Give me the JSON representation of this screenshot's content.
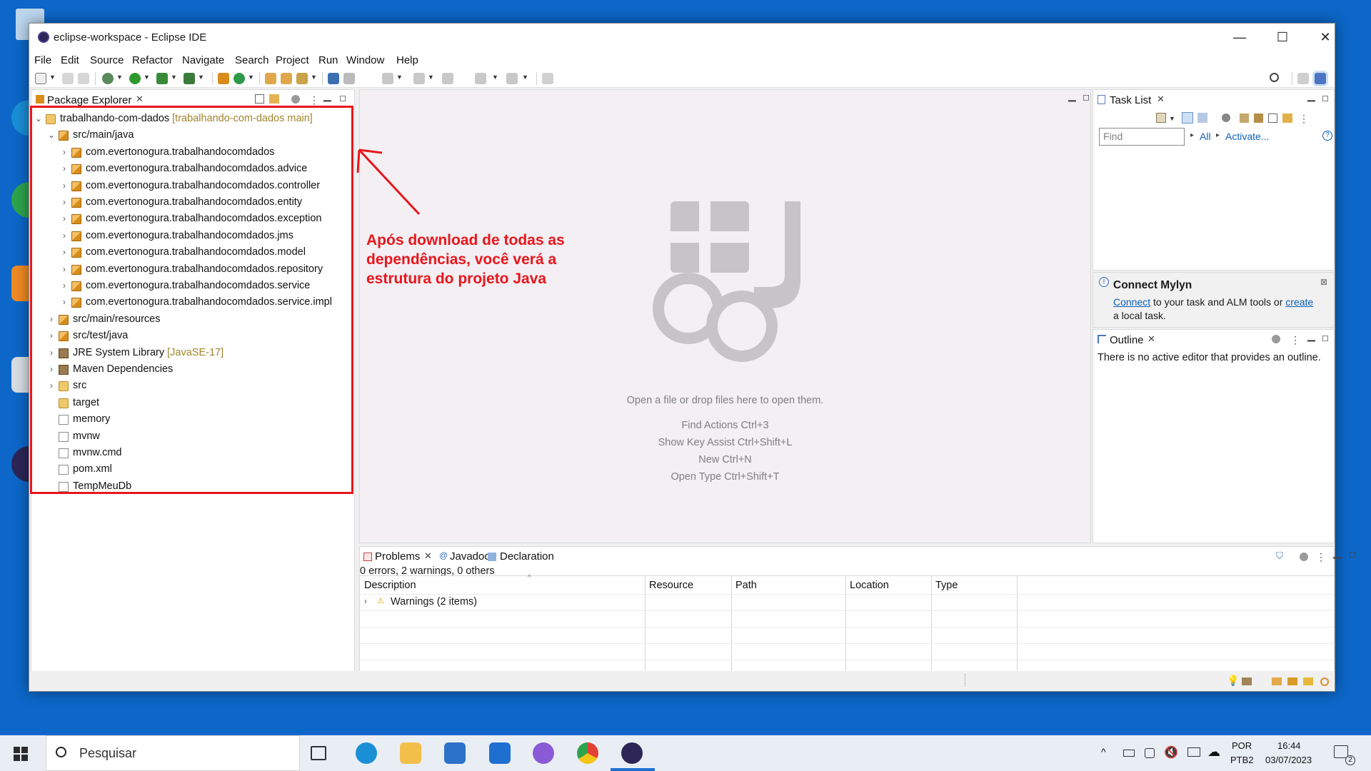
{
  "window": {
    "title": "eclipse-workspace - Eclipse IDE",
    "minimize": "—",
    "maximize": "☐",
    "close": "✕"
  },
  "menu": [
    "File",
    "Edit",
    "Source",
    "Refactor",
    "Navigate",
    "Search",
    "Project",
    "Run",
    "Window",
    "Help"
  ],
  "package_explorer": {
    "tab": "Package Explorer",
    "tree": [
      {
        "label": "trabalhando-com-dados",
        "deco": "[trabalhando-com-dados main]",
        "icon": "project-icon",
        "toggle": "⌄"
      },
      {
        "label": "src/main/java",
        "deco": "",
        "icon": "source-folder-icon",
        "toggle": "⌄"
      },
      {
        "label": "com.evertonogura.trabalhandocomdados",
        "deco": "",
        "icon": "package-icon",
        "toggle": "›"
      },
      {
        "label": "com.evertonogura.trabalhandocomdados.advice",
        "deco": "",
        "icon": "package-icon",
        "toggle": "›"
      },
      {
        "label": "com.evertonogura.trabalhandocomdados.controller",
        "deco": "",
        "icon": "package-icon",
        "toggle": "›"
      },
      {
        "label": "com.evertonogura.trabalhandocomdados.entity",
        "deco": "",
        "icon": "package-icon",
        "toggle": "›"
      },
      {
        "label": "com.evertonogura.trabalhandocomdados.exception",
        "deco": "",
        "icon": "package-icon",
        "toggle": "›"
      },
      {
        "label": "com.evertonogura.trabalhandocomdados.jms",
        "deco": "",
        "icon": "package-icon",
        "toggle": "›"
      },
      {
        "label": "com.evertonogura.trabalhandocomdados.model",
        "deco": "",
        "icon": "package-icon",
        "toggle": "›"
      },
      {
        "label": "com.evertonogura.trabalhandocomdados.repository",
        "deco": "",
        "icon": "package-icon",
        "toggle": "›"
      },
      {
        "label": "com.evertonogura.trabalhandocomdados.service",
        "deco": "",
        "icon": "package-icon",
        "toggle": "›"
      },
      {
        "label": "com.evertonogura.trabalhandocomdados.service.impl",
        "deco": "",
        "icon": "package-icon",
        "toggle": "›"
      },
      {
        "label": "src/main/resources",
        "deco": "",
        "icon": "source-folder-icon",
        "toggle": "›"
      },
      {
        "label": "src/test/java",
        "deco": "",
        "icon": "source-folder-icon",
        "toggle": "›"
      },
      {
        "label": "JRE System Library",
        "deco": "[JavaSE-17]",
        "icon": "library-icon",
        "toggle": "›"
      },
      {
        "label": "Maven Dependencies",
        "deco": "",
        "icon": "library-icon",
        "toggle": "›"
      },
      {
        "label": "src",
        "deco": "",
        "icon": "folder-icon",
        "toggle": "›"
      },
      {
        "label": "target",
        "deco": "",
        "icon": "folder-icon",
        "toggle": ""
      },
      {
        "label": "memory",
        "deco": "",
        "icon": "file-icon",
        "toggle": ""
      },
      {
        "label": "mvnw",
        "deco": "",
        "icon": "file-icon",
        "toggle": ""
      },
      {
        "label": "mvnw.cmd",
        "deco": "",
        "icon": "file-icon",
        "toggle": ""
      },
      {
        "label": "pom.xml",
        "deco": "",
        "icon": "xml-file-icon",
        "toggle": ""
      },
      {
        "label": "TempMeuDb",
        "deco": "",
        "icon": "file-icon",
        "toggle": ""
      }
    ]
  },
  "annotation": {
    "text": "Após download de todas as dependências, você verá a estrutura do projeto Java"
  },
  "editor": {
    "open_hint": "Open a file or drop files here to open them.",
    "shortcuts": [
      "Find Actions Ctrl+3",
      "Show Key Assist Ctrl+Shift+L",
      "New Ctrl+N",
      "Open Type Ctrl+Shift+T"
    ]
  },
  "task_list": {
    "tab": "Task List",
    "find_placeholder": "Find",
    "all": "All",
    "activate": "Activate..."
  },
  "mylyn": {
    "title": "Connect Mylyn",
    "connect": "Connect",
    "middle": " to your task and ALM tools or ",
    "create": "create",
    "end": "a local task."
  },
  "outline": {
    "tab": "Outline",
    "message": "There is no active editor that provides an outline."
  },
  "problems": {
    "tabs": [
      "Problems",
      "Javadoc",
      "Declaration"
    ],
    "summary": "0 errors, 2 warnings, 0 others",
    "columns": [
      "Description",
      "Resource",
      "Path",
      "Location",
      "Type"
    ],
    "rows": [
      {
        "description": "Warnings (2 items)"
      }
    ]
  },
  "taskbar": {
    "search": "Pesquisar",
    "lang1": "POR",
    "lang2": "PTB2",
    "time": "16:44",
    "date": "03/07/2023",
    "notifications": "2"
  },
  "colors": {
    "accent": "#e8161b",
    "link": "#0b5fba",
    "desktop": "#0c67c8"
  }
}
